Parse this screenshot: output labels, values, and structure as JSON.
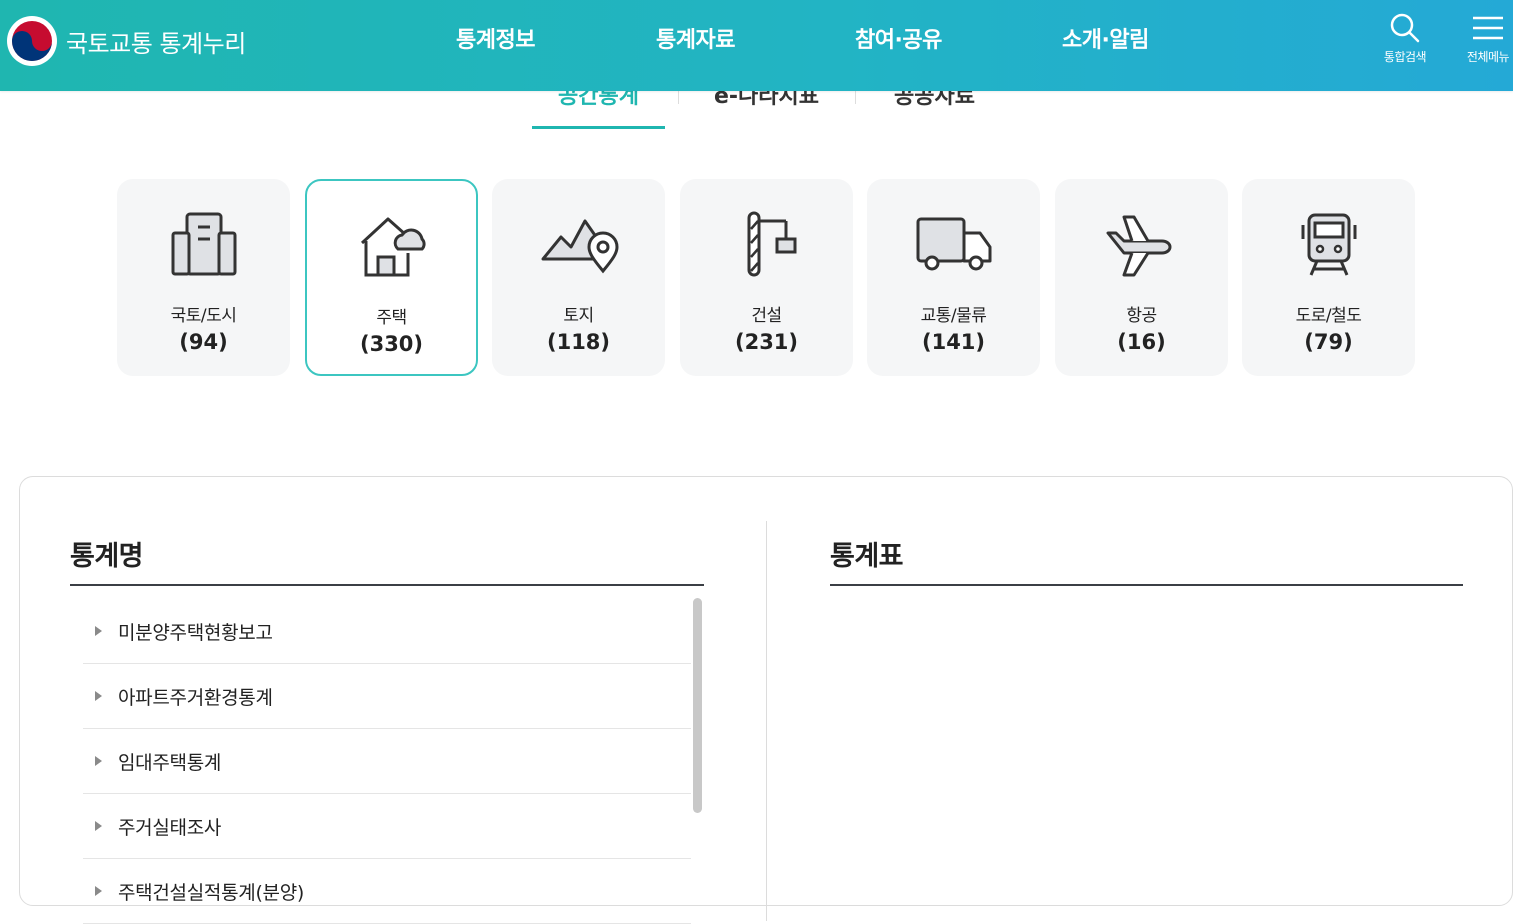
{
  "header": {
    "site_name": "국토교통 통계누리",
    "nav": [
      "통계정보",
      "통계자료",
      "참여·공유",
      "소개·알림"
    ],
    "search_label": "통합검색",
    "menu_label": "전체메뉴"
  },
  "subtabs": {
    "items": [
      "공간통계",
      "e-나라지표",
      "공공자료"
    ],
    "active_index": 0
  },
  "categories": [
    {
      "name": "국토/도시",
      "count": "(94)",
      "icon": "building-icon"
    },
    {
      "name": "주택",
      "count": "(330)",
      "icon": "house-cloud-icon",
      "selected": true
    },
    {
      "name": "토지",
      "count": "(118)",
      "icon": "land-pin-icon"
    },
    {
      "name": "건설",
      "count": "(231)",
      "icon": "crane-icon"
    },
    {
      "name": "교통/물류",
      "count": "(141)",
      "icon": "truck-icon"
    },
    {
      "name": "항공",
      "count": "(16)",
      "icon": "airplane-icon"
    },
    {
      "name": "도로/철도",
      "count": "(79)",
      "icon": "train-icon"
    }
  ],
  "panel": {
    "left_title": "통계명",
    "right_title": "통계표",
    "stat_names": [
      "미분양주택현황보고",
      "아파트주거환경통계",
      "임대주택통계",
      "주거실태조사",
      "주택건설실적통계(분양)"
    ]
  },
  "colors": {
    "accent": "#1fb6b0",
    "header_gradient_end": "#24a9d6",
    "card_bg": "#f5f6f7",
    "card_selected_border": "#3cc6c1"
  }
}
